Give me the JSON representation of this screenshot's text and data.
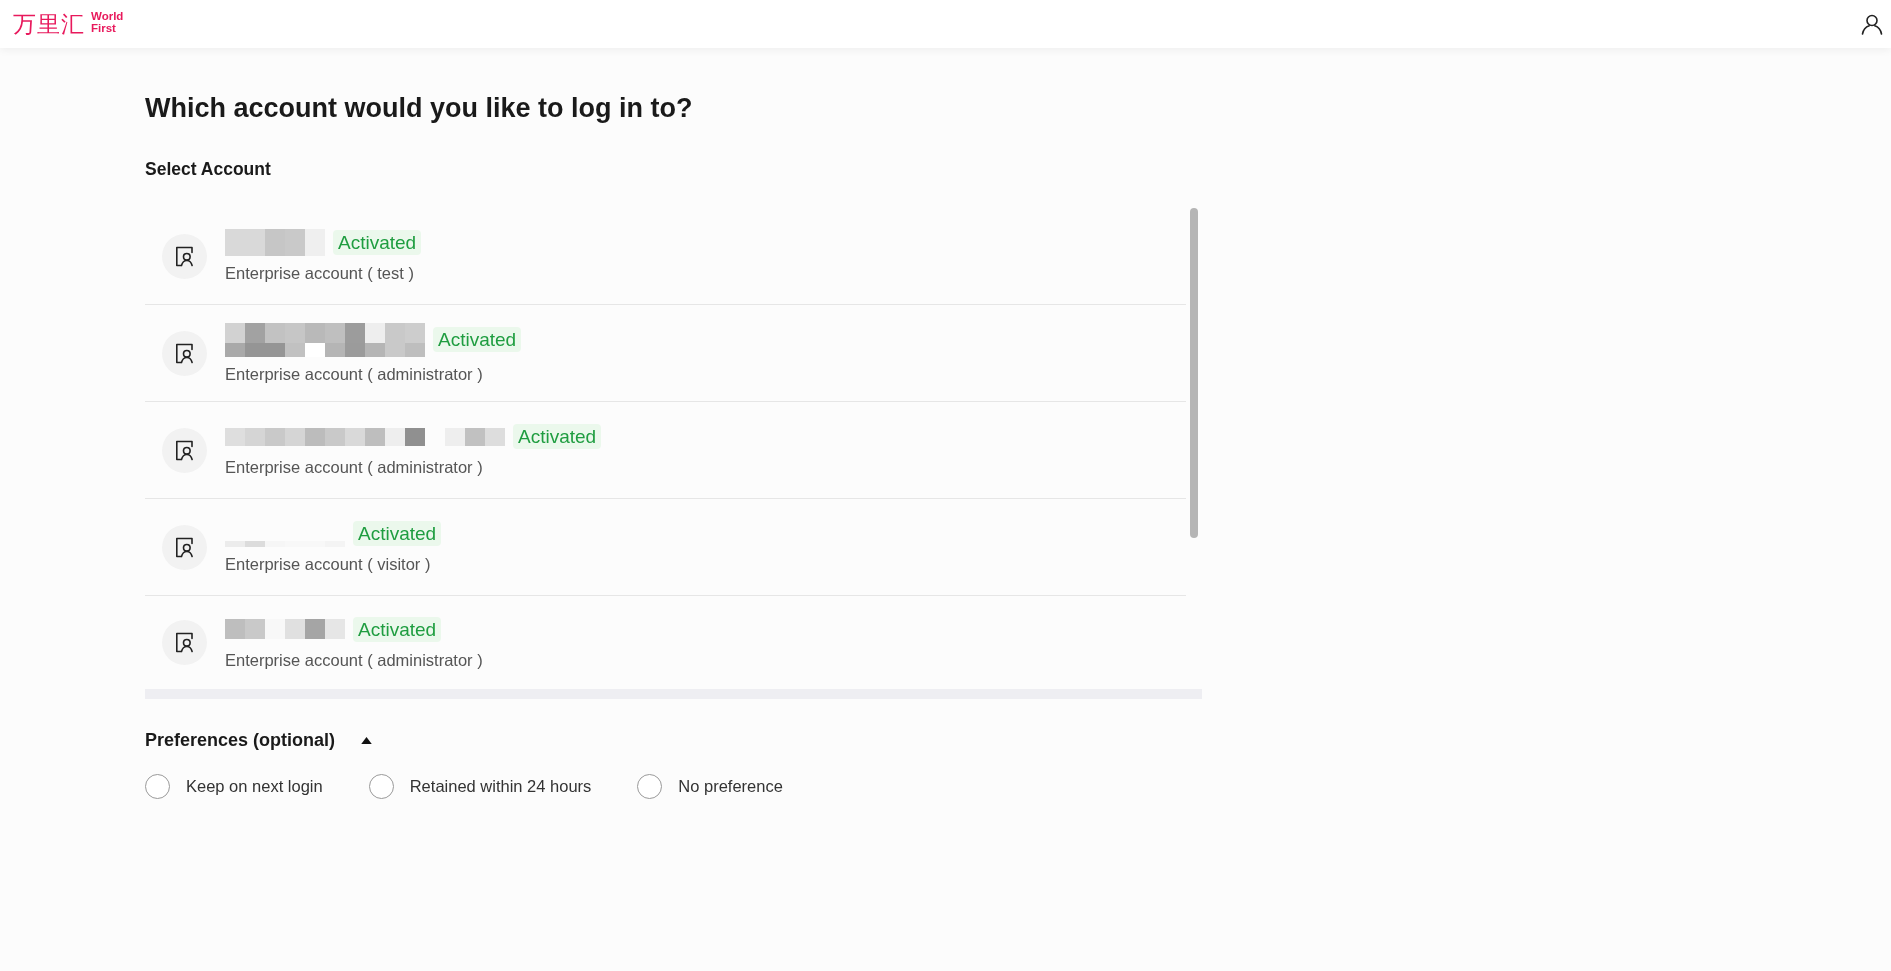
{
  "header": {
    "logo": {
      "name_cn": "万里汇",
      "name_en": "World First"
    }
  },
  "page": {
    "title": "Which account would you like to log in to?",
    "section_label": "Select Account"
  },
  "accounts": [
    {
      "name_pixelated": true,
      "status": "Activated",
      "description": "Enterprise account ( test )"
    },
    {
      "name_pixelated": true,
      "status": "Activated",
      "description": "Enterprise account ( administrator )"
    },
    {
      "name_pixelated": true,
      "status": "Activated",
      "description": "Enterprise account ( administrator )"
    },
    {
      "name_pixelated": true,
      "status": "Activated",
      "description": "Enterprise account ( visitor )"
    },
    {
      "name_pixelated": true,
      "status": "Activated",
      "description": "Enterprise account ( administrator )"
    }
  ],
  "preferences": {
    "title": "Preferences (optional)",
    "expanded": true,
    "options": [
      {
        "label": "Keep on next login",
        "selected": false
      },
      {
        "label": "Retained within 24 hours",
        "selected": false
      },
      {
        "label": "No preference",
        "selected": false
      }
    ]
  }
}
